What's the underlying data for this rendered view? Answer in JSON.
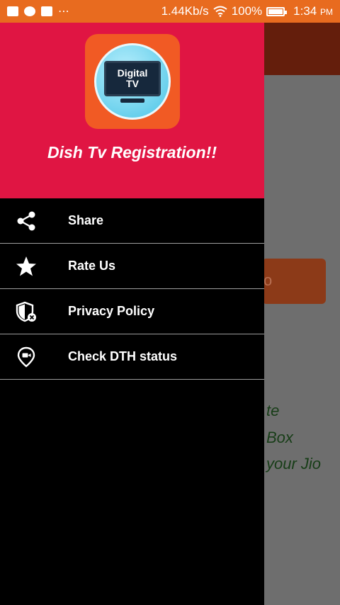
{
  "status_bar": {
    "dots": "⋯",
    "speed": "1.44Kb/s",
    "battery": "100%",
    "time": "1:34",
    "ampm": "PM"
  },
  "background": {
    "button_text": "o",
    "lines": [
      "te",
      "Box",
      "your Jio"
    ]
  },
  "drawer": {
    "title": "Dish Tv Registration!!",
    "logo_text_1": "Digital",
    "logo_text_2": "TV",
    "items": [
      {
        "label": "Share",
        "icon": "share-icon"
      },
      {
        "label": "Rate Us",
        "icon": "star-icon"
      },
      {
        "label": "Privacy Policy",
        "icon": "privacy-shield-icon"
      },
      {
        "label": "Check DTH status",
        "icon": "location-camera-icon"
      }
    ]
  },
  "colors": {
    "status_bar": "#e86b1f",
    "drawer_header": "#e01543",
    "drawer_body": "#000000",
    "logo_bg": "#f15a24"
  }
}
